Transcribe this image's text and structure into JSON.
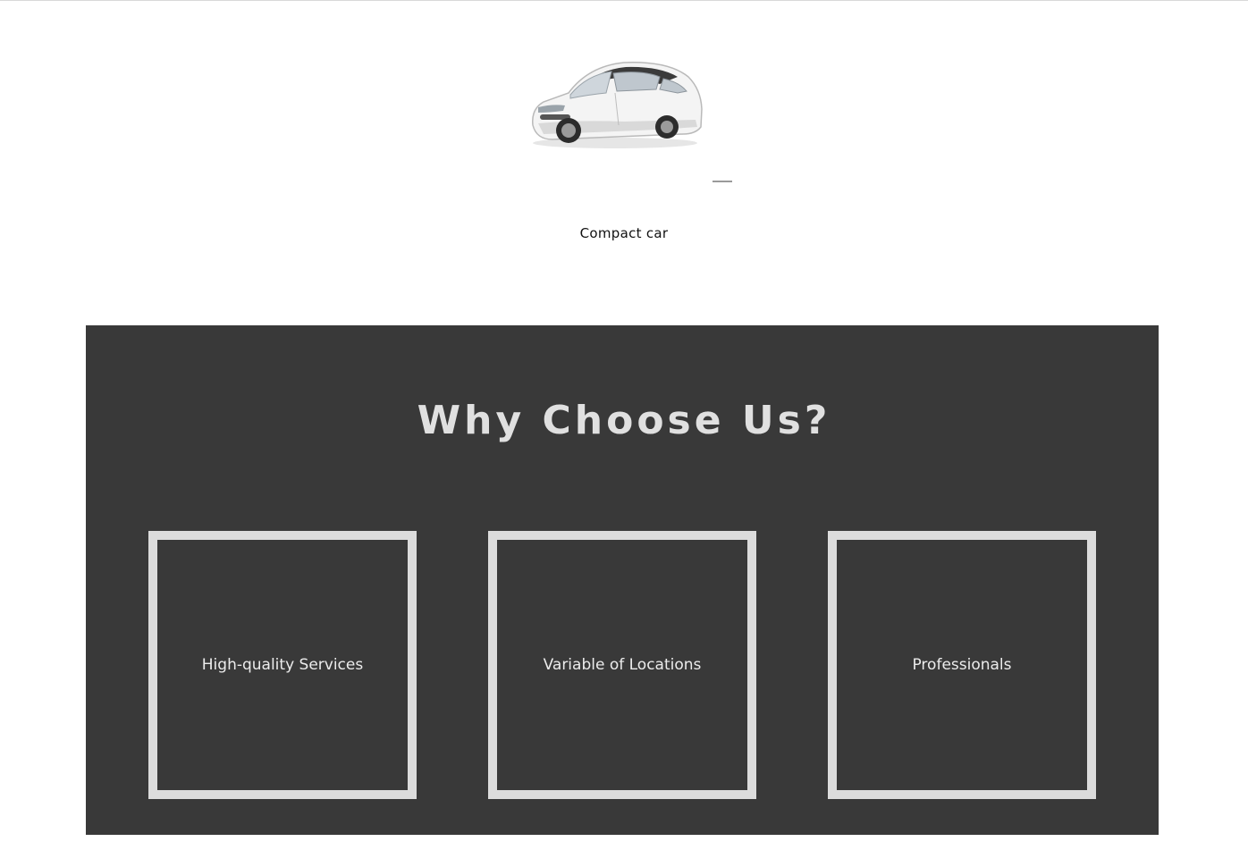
{
  "car": {
    "image_name": "compact-car-photo",
    "caption": "Compact car"
  },
  "why": {
    "title": "Why Choose Us?",
    "features": [
      {
        "label": "High-quality Services"
      },
      {
        "label": "Variable of Locations"
      },
      {
        "label": "Professionals"
      }
    ]
  },
  "colors": {
    "section_bg": "#393939",
    "box_border": "#dcdcdc",
    "title_text": "#e0e0e0",
    "page_bg": "#ffffff"
  }
}
